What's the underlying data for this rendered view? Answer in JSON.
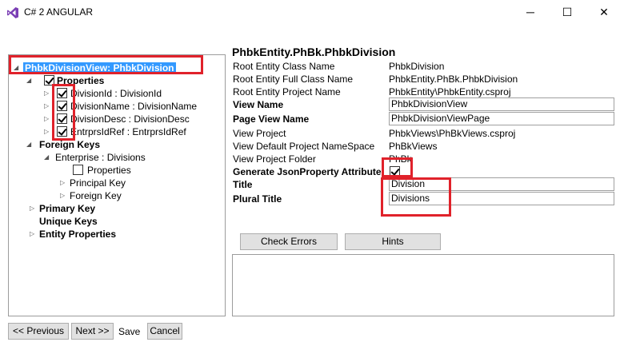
{
  "window": {
    "title": "C# 2 ANGULAR",
    "minimize": "─",
    "maximize": "☐",
    "close": "✕"
  },
  "tree": {
    "root": "PhbkDivisionView: PhbkDivision",
    "properties": "Properties",
    "items": [
      {
        "label": "DivisionId : DivisionId",
        "checked": true
      },
      {
        "label": "DivisionName : DivisionName",
        "checked": true
      },
      {
        "label": "DivisionDesc : DivisionDesc",
        "checked": true
      },
      {
        "label": "EntrprsIdRef : EntrprsIdRef",
        "checked": true
      }
    ],
    "foreign_keys": "Foreign Keys",
    "enterprise": "Enterprise : Divisions",
    "fk_properties": "Properties",
    "principal_key": "Principal Key",
    "foreign_key": "Foreign Key",
    "primary_key": "Primary Key",
    "unique_keys": "Unique Keys",
    "entity_properties": "Entity Properties"
  },
  "details": {
    "header": "PhbkEntity.PhBk.PhbkDivision",
    "rows": [
      {
        "label": "Root Entity Class Name",
        "value": "PhbkDivision"
      },
      {
        "label": "Root Entity Full Class Name",
        "value": "PhbkEntity.PhBk.PhbkDivision"
      },
      {
        "label": "Root Entity Project Name",
        "value": "PhbkEntity\\PhbkEntity.csproj"
      }
    ],
    "view_name_label": "View Name",
    "view_name_value": "PhbkDivisionView",
    "page_view_name_label": "Page View Name",
    "page_view_name_value": "PhbkDivisionViewPage",
    "view_project_label": "View Project",
    "view_project_value": "PhbkViews\\PhBkViews.csproj",
    "view_ns_label": "View Default Project NameSpace",
    "view_ns_value": "PhBkViews",
    "view_folder_label": "View Project Folder",
    "view_folder_value": "PhBk",
    "gen_json_label": "Generate JsonProperty Attribute",
    "gen_json_checked": true,
    "title_label": "Title",
    "title_value": "Division",
    "plural_title_label": "Plural Title",
    "plural_title_value": "Divisions"
  },
  "buttons": {
    "check_errors": "Check Errors",
    "hints": "Hints",
    "previous": "<< Previous",
    "next": "Next >>",
    "save": "Save",
    "cancel": "Cancel"
  },
  "colors": {
    "highlight": "#e0222b",
    "selection": "#3399ff"
  }
}
